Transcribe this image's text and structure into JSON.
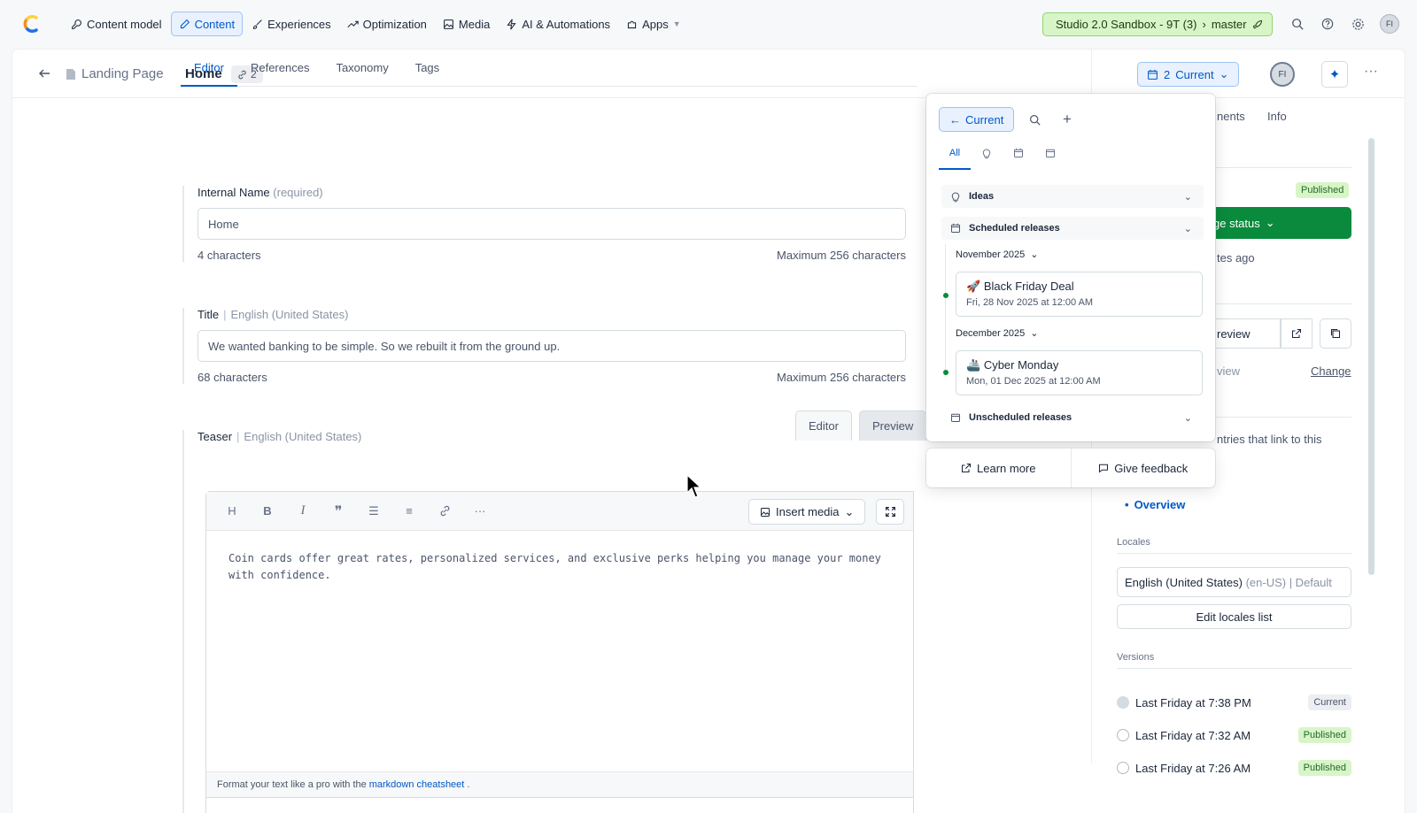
{
  "nav": {
    "items": [
      {
        "label": "Content model",
        "icon": "wrench-icon"
      },
      {
        "label": "Content",
        "icon": "pen-icon",
        "active": true
      },
      {
        "label": "Experiences",
        "icon": "brush-icon"
      },
      {
        "label": "Optimization",
        "icon": "trend-icon"
      },
      {
        "label": "Media",
        "icon": "image-icon"
      },
      {
        "label": "AI & Automations",
        "icon": "bolt-icon"
      },
      {
        "label": "Apps",
        "icon": "puzzle-icon"
      }
    ],
    "space": "Studio 2.0 Sandbox - 9T (3)",
    "environment": "master",
    "user_initials": "FI"
  },
  "entry": {
    "content_type": "Landing Page",
    "title": "Home",
    "references_count": "2",
    "release_count": "2",
    "release_label": "Current",
    "user_initials": "FI"
  },
  "tabs": [
    "Editor",
    "References",
    "Taxonomy",
    "Tags"
  ],
  "fields": {
    "internal_name": {
      "label": "Internal Name",
      "qualifier": "(required)",
      "value": "Home",
      "count": "4 characters",
      "max": "Maximum 256 characters"
    },
    "title": {
      "label": "Title",
      "locale": "English (United States)",
      "value": "We wanted banking to be simple. So we rebuilt it from the ground up.",
      "count": "68 characters",
      "max": "Maximum 256 characters"
    },
    "teaser": {
      "label": "Teaser",
      "locale": "English (United States)",
      "editor_tab": "Editor",
      "preview_tab": "Preview",
      "insert_media": "Insert media",
      "text": "Coin cards offer great rates, personalized services, and exclusive perks helping you manage your money with confidence.",
      "footer_prefix": "Format your text like a pro with the",
      "footer_link": "markdown cheatsheet",
      "footer_suffix": "."
    }
  },
  "sidebar": {
    "tab_comments_partial": "nents",
    "tab_info": "Info",
    "status_badge": "Published",
    "change_status_partial": "ge status",
    "time_partial": "tes ago",
    "preview_partial": "review",
    "preview_label_partial": "view",
    "change_link": "Change",
    "links_partial": "ntries that link to this",
    "link_item": "Overview",
    "locales_heading": "Locales",
    "locale_name": "English (United States)",
    "locale_code": "(en-US) | Default",
    "edit_locales": "Edit locales list",
    "versions_heading": "Versions",
    "versions": [
      {
        "label": "Last Friday at 7:38 PM",
        "badge": "Current"
      },
      {
        "label": "Last Friday at 7:32 AM",
        "badge": "Published"
      },
      {
        "label": "Last Friday at 7:26 AM",
        "badge": "Published"
      }
    ]
  },
  "releases_popover": {
    "back_label": "Current",
    "filter_all": "All",
    "groups": {
      "ideas": "Ideas",
      "scheduled": "Scheduled releases",
      "unscheduled": "Unscheduled releases"
    },
    "months": [
      {
        "label": "November 2025",
        "release": {
          "emoji": "🚀",
          "name": "Black Friday Deal",
          "date": "Fri, 28 Nov 2025 at 12:00 AM"
        }
      },
      {
        "label": "December 2025",
        "release": {
          "emoji": "🚢",
          "name": "Cyber Monday",
          "date": "Mon, 01 Dec 2025 at 12:00 AM"
        }
      }
    ],
    "learn_more": "Learn more",
    "give_feedback": "Give feedback"
  },
  "colors": {
    "accent": "#0059c8",
    "published_green": "#0a8a3c",
    "sandbox_bg": "#d8f5c8"
  }
}
